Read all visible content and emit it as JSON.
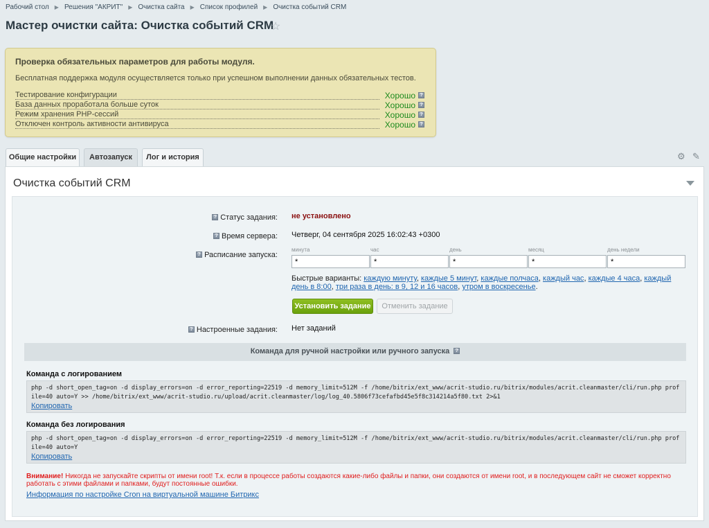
{
  "breadcrumbs": [
    "Рабочий стол",
    "Решения \"АКРИТ\"",
    "Очистка сайта",
    "Список профилей",
    "Очистка событий CRM"
  ],
  "page_title": "Мастер очистки сайта: Очистка событий CRM",
  "check": {
    "title": "Проверка обязательных параметров для работы модуля.",
    "note": "Бесплатная поддержка модуля осуществляется только при успешном выполнении данных обязательных тестов.",
    "rows": [
      {
        "label": "Тестирование конфигурации",
        "result": "Хорошо"
      },
      {
        "label": "База данных проработала больше суток",
        "result": "Хорошо"
      },
      {
        "label": "Режим хранения PHP-сессий",
        "result": "Хорошо"
      },
      {
        "label": "Отключен контроль активности антивируса",
        "result": "Хорошо"
      }
    ]
  },
  "tabs": [
    {
      "label": "Общие настройки"
    },
    {
      "label": "Автозапуск"
    },
    {
      "label": "Лог и история"
    }
  ],
  "panel": {
    "title": "Очистка событий CRM",
    "status_label": "Статус задания:",
    "status_value": "не установлено",
    "server_time_label": "Время сервера:",
    "server_time_value": "Четверг, 04 сентября 2025 16:02:43 +0300",
    "schedule_label": "Расписание запуска:",
    "schedule_fields": [
      {
        "caption": "минута",
        "value": "*"
      },
      {
        "caption": "час",
        "value": "*"
      },
      {
        "caption": "день",
        "value": "*"
      },
      {
        "caption": "месяц",
        "value": "*"
      },
      {
        "caption": "день недели",
        "value": "*"
      }
    ],
    "quick_label": "Быстрые варианты:",
    "quick_options": [
      "каждую минуту",
      "каждые 5 минут",
      "каждые полчаса",
      "каждый час",
      "каждые 4 часа",
      "каждый день в 8:00",
      "три раза в день: в 9, 12 и 16 часов",
      "утром в воскресенье"
    ],
    "set_button": "Установить задание",
    "cancel_button": "Отменить задание",
    "configured_label": "Настроенные задания:",
    "configured_value": "Нет заданий",
    "cmd_header": "Команда для ручной настройки или ручного запуска",
    "cmd_log_title": "Команда с логированием",
    "cmd_log": "php -d short_open_tag=on -d display_errors=on -d error_reporting=22519 -d memory_limit=512M -f /home/bitrix/ext_www/acrit-studio.ru/bitrix/modules/acrit.cleanmaster/cli/run.php profile=40 auto=Y >> /home/bitrix/ext_www/acrit-studio.ru/upload/acrit.cleanmaster/log/log_40.5806f73cefafbd45e5f8c314214a5f80.txt 2>&1",
    "cmd_nolog_title": "Команда без логирования",
    "cmd_nolog": "php -d short_open_tag=on -d display_errors=on -d error_reporting=22519 -d memory_limit=512M -f /home/bitrix/ext_www/acrit-studio.ru/bitrix/modules/acrit.cleanmaster/cli/run.php profile=40 auto=Y",
    "copy_label": "Копировать",
    "warning_strong": "Внимание!",
    "warning_text": " Никогда не запускайте скрипты от имени root! Т.к. если в процессе работы создаются какие-либо файлы и папки, они создаются от имени root, и в последующем сайт не сможет корректно работать с этими файлами и папками, будут постоянные ошибки.",
    "info_link": "Информация по настройке Cron на виртуальной машине Битрикс"
  }
}
